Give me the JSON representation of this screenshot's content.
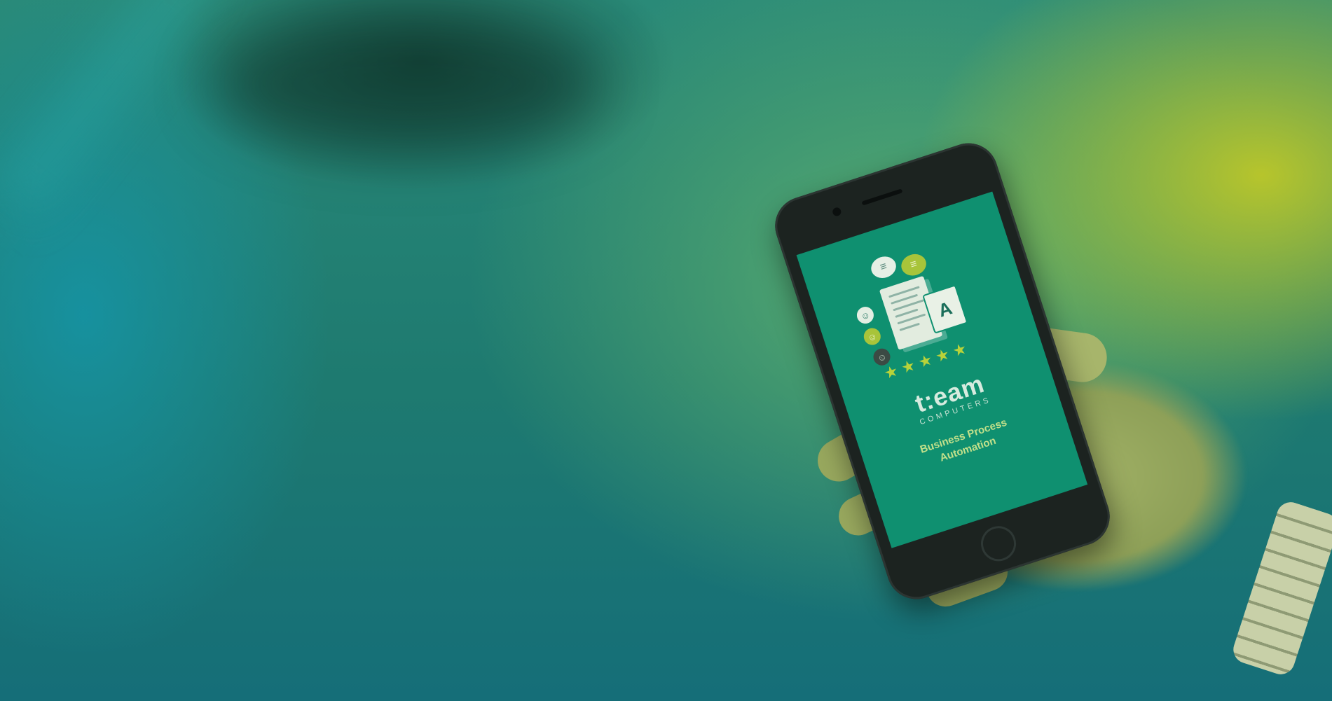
{
  "scene": {
    "accent_colors": {
      "teal": "#1e7a70",
      "green": "#64b46e",
      "lime": "#bec828",
      "screen": "#0f9070"
    }
  },
  "phone_screen": {
    "logo": {
      "word": "t:eam",
      "sub": "COMPUTERS"
    },
    "tagline_line1": "Business Process",
    "tagline_line2": "Automation",
    "rating_stars": 5,
    "icons": [
      "chat-bubble-icon",
      "chat-bubble-icon",
      "document-icon",
      "badge-icon",
      "user-icon",
      "user-icon",
      "user-icon",
      "star-icon"
    ]
  }
}
